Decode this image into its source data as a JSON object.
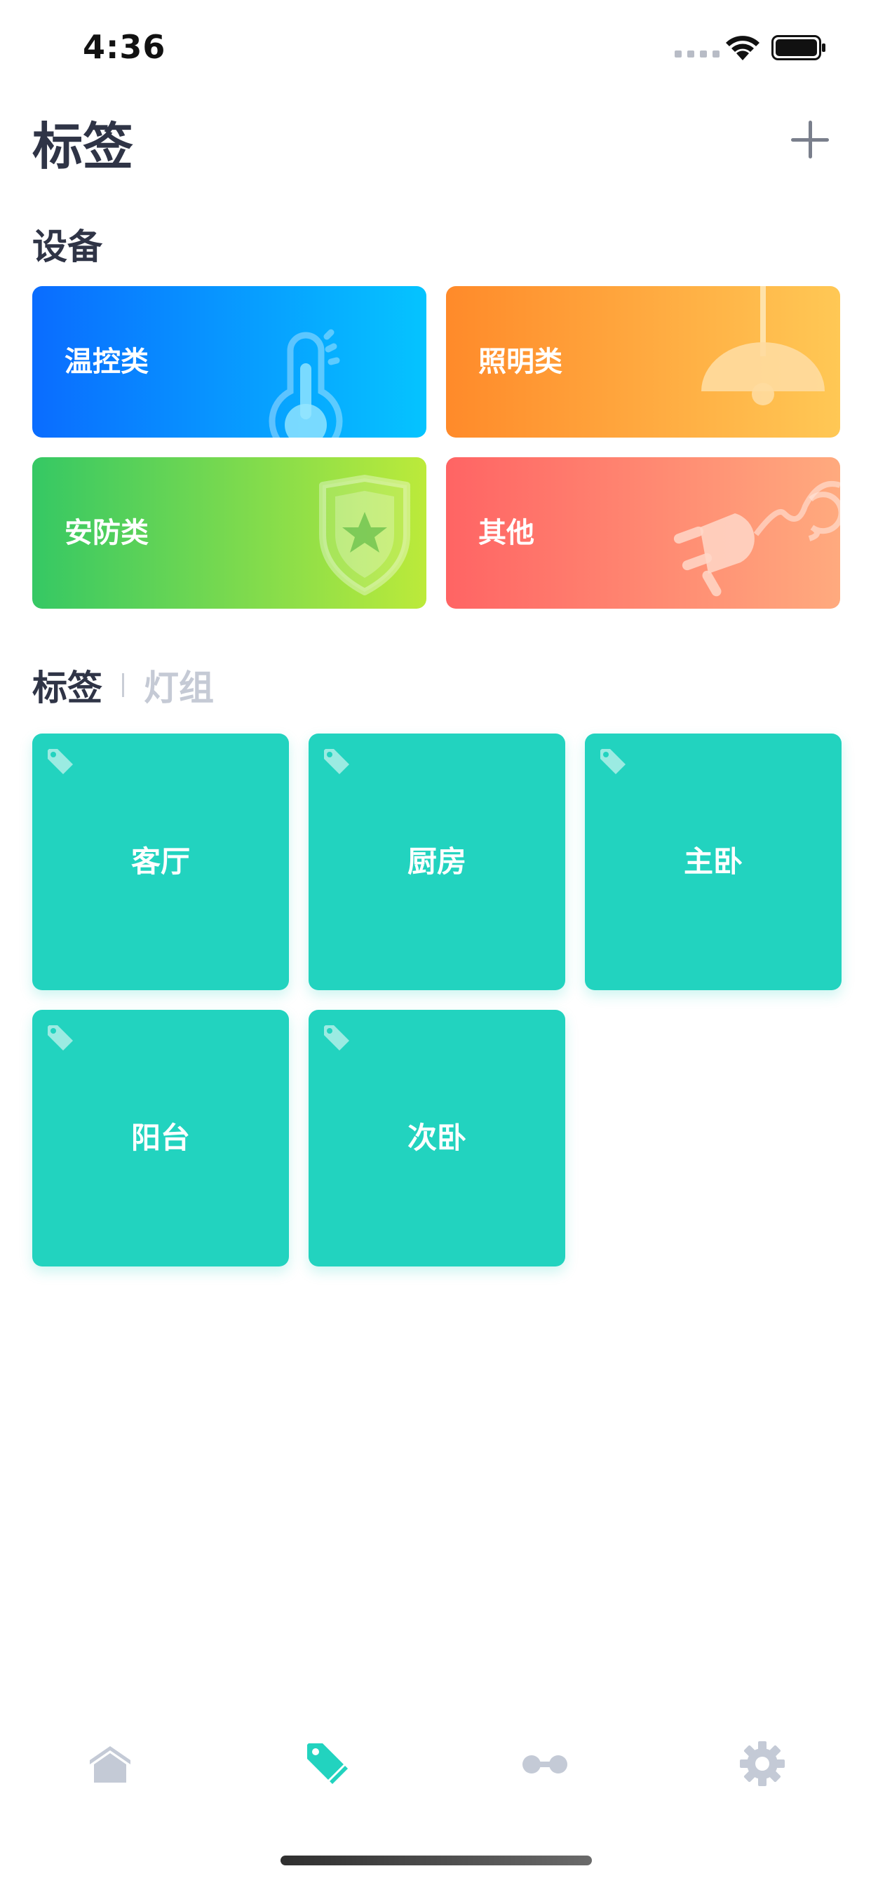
{
  "status_bar": {
    "time": "4:36"
  },
  "header": {
    "title": "标签"
  },
  "devices": {
    "heading": "设备",
    "cards": [
      {
        "label": "温控类",
        "icon": "thermometer-icon"
      },
      {
        "label": "照明类",
        "icon": "lamp-icon"
      },
      {
        "label": "安防类",
        "icon": "shield-star-icon"
      },
      {
        "label": "其他",
        "icon": "plug-icon"
      }
    ]
  },
  "tags": {
    "tabs": [
      {
        "label": "标签",
        "active": true
      },
      {
        "label": "灯组",
        "active": false
      }
    ],
    "items": [
      {
        "label": "客厅"
      },
      {
        "label": "厨房"
      },
      {
        "label": "主卧"
      },
      {
        "label": "阳台"
      },
      {
        "label": "次卧"
      }
    ]
  },
  "bottom_nav": {
    "items": [
      {
        "icon": "home-icon",
        "active": false
      },
      {
        "icon": "tag-icon",
        "active": true
      },
      {
        "icon": "scenes-icon",
        "active": false
      },
      {
        "icon": "gear-icon",
        "active": false
      }
    ]
  },
  "colors": {
    "accent": "#22d3bf",
    "inactive_nav": "#c4cad6",
    "text_primary": "#2f3446",
    "text_muted": "#c5cad5"
  }
}
